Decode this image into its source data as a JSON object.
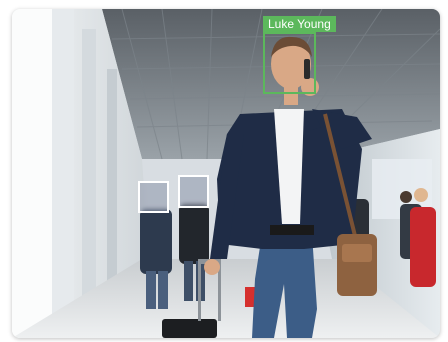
{
  "detections": {
    "recognized": {
      "name": "Luke Young",
      "color": "#5cb85c"
    },
    "unknown_color": "#ffffff"
  }
}
